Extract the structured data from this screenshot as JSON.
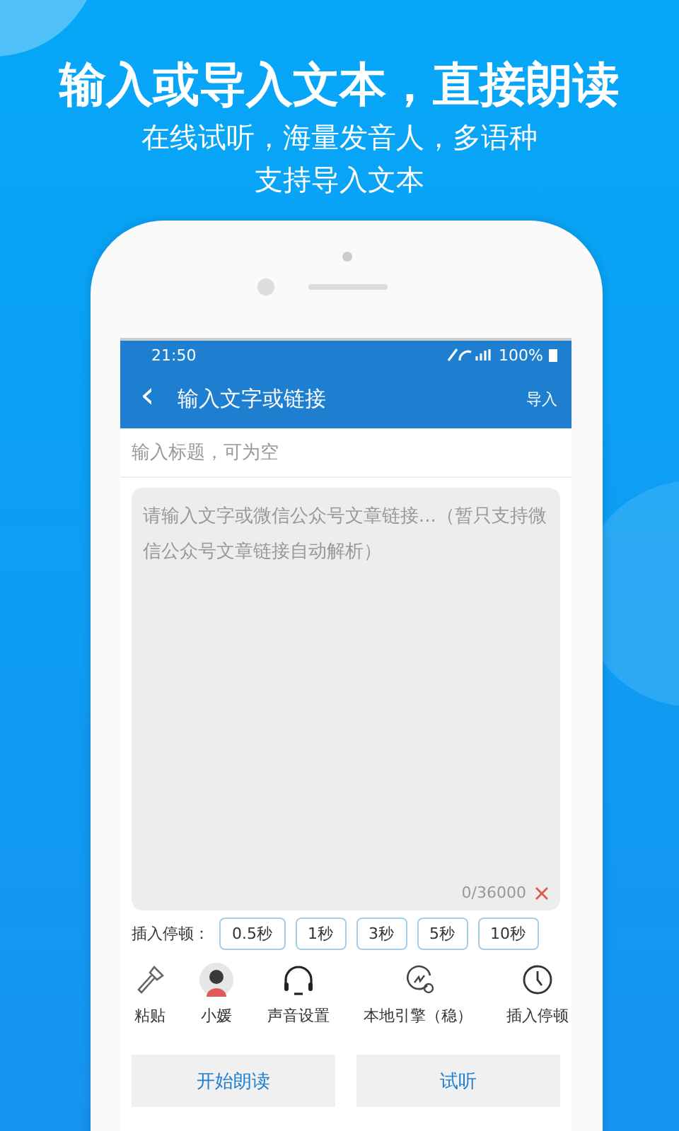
{
  "headline": "输入或导入文本，直接朗读",
  "subtitle_lines": [
    "在线试听，海量发音人，多语种",
    "支持导入文本"
  ],
  "status_bar": {
    "time": "21:50",
    "battery": "100%"
  },
  "app_bar": {
    "back": "‹",
    "title": "输入文字或链接",
    "action": "导入"
  },
  "title_field": {
    "placeholder": "输入标题，可为空"
  },
  "text_area": {
    "placeholder": "请输入文字或微信公众号文章链接...（暂只支持微信公众号文章链接自动解析）",
    "count": "0/36000"
  },
  "pause_row": {
    "label": "插入停顿：",
    "options": [
      "0.5秒",
      "1秒",
      "3秒",
      "5秒",
      "10秒"
    ]
  },
  "toolbar": [
    {
      "label": "粘贴"
    },
    {
      "label": "小媛"
    },
    {
      "label": "声音设置"
    },
    {
      "label": "本地引擎（稳）"
    },
    {
      "label": "插入停顿"
    }
  ],
  "buttons": [
    "开始朗读",
    "试听"
  ]
}
